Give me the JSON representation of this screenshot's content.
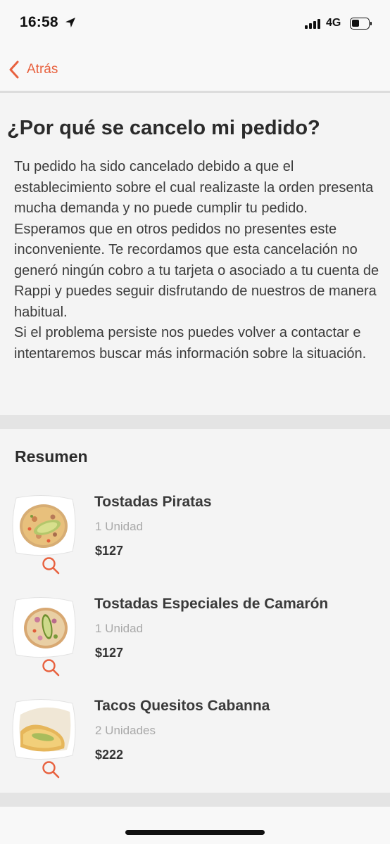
{
  "status_bar": {
    "time": "16:58",
    "network": "4G"
  },
  "nav": {
    "back_label": "Atrás",
    "back_icon": "chevron-left-icon"
  },
  "page": {
    "title": "¿Por qué se cancelo mi pedido?",
    "body": "Tu pedido ha sido cancelado debido a que el establecimiento sobre el cual realizaste la orden presenta mucha demanda y no puede cumplir tu pedido.\n Esperamos que en otros pedidos no presentes este inconveniente. Te recordamos que esta cancelación no generó ningún cobro a tu tarjeta o asociado a tu cuenta de Rappi y puedes seguir disfrutando de nuestros de manera habitual.\nSi el problema persiste nos puedes volver a contactar e intentaremos buscar más información sobre la situación."
  },
  "summary": {
    "heading": "Resumen",
    "items": [
      {
        "name": "Tostadas Piratas",
        "quantity": "1 Unidad",
        "price": "$127"
      },
      {
        "name": "Tostadas Especiales de Camarón",
        "quantity": "1 Unidad",
        "price": "$127"
      },
      {
        "name": "Tacos Quesitos Cabanna",
        "quantity": "2 Unidades",
        "price": "$222"
      }
    ]
  },
  "colors": {
    "accent": "#e8613e",
    "background": "#f4f4f4",
    "divider": "#e4e4e4",
    "secondary_text": "#a9a9a9"
  },
  "icons": {
    "zoom": "search-icon",
    "location": "location-arrow-icon",
    "battery": "battery-icon",
    "signal": "signal-icon"
  }
}
